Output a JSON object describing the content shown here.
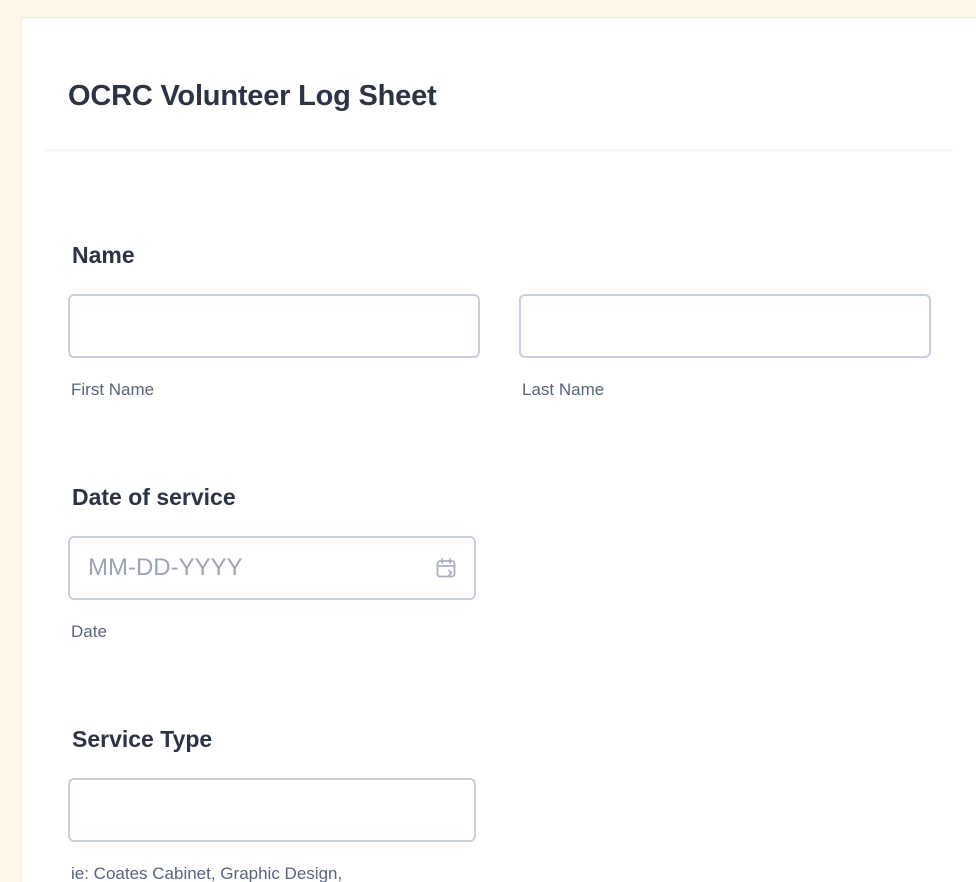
{
  "form": {
    "title": "OCRC Volunteer Log Sheet"
  },
  "name_field": {
    "label": "Name",
    "first_sublabel": "First Name",
    "last_sublabel": "Last Name",
    "first_value": "",
    "last_value": ""
  },
  "date_field": {
    "label": "Date of service",
    "placeholder": "MM-DD-YYYY",
    "sublabel": "Date",
    "icon": "calendar-icon"
  },
  "service_field": {
    "label": "Service Type",
    "value": "",
    "sublabel": "ie: Coates Cabinet, Graphic Design,"
  },
  "colors": {
    "page_background": "#fdf7ea",
    "text": "#2c3345",
    "sublabel": "#57647e",
    "input_border": "#c9cfdc",
    "placeholder": "#9ba3b6"
  }
}
